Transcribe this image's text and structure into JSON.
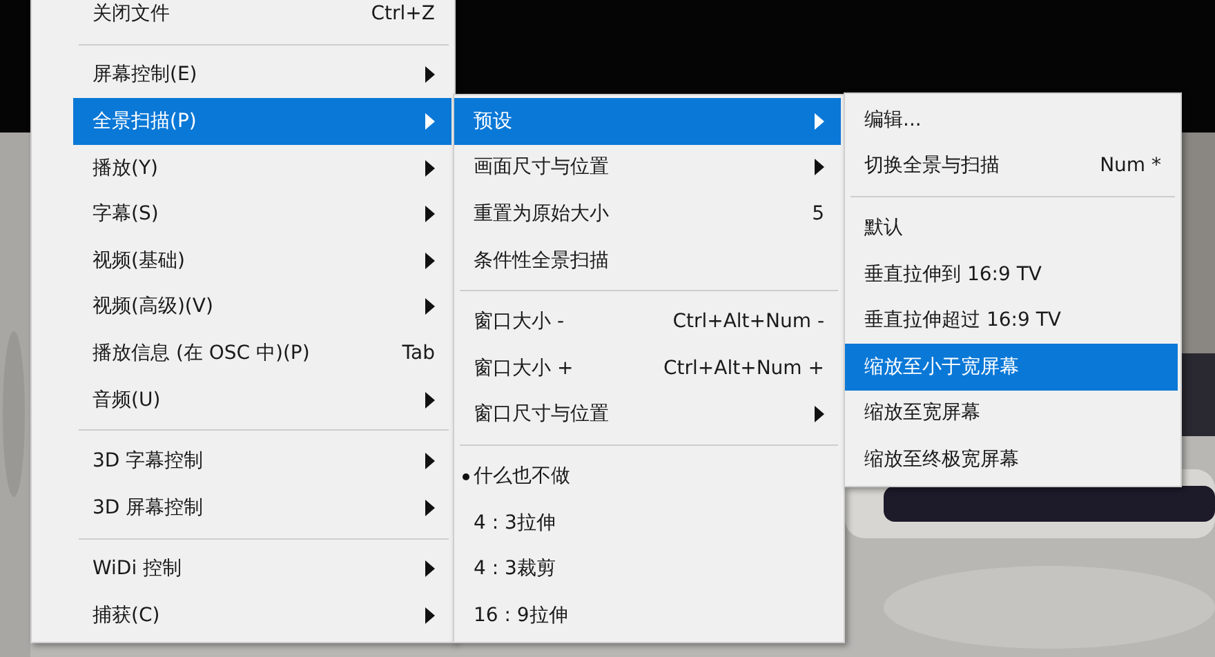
{
  "menus": [
    {
      "items": [
        {
          "kind": "command",
          "label": "关闭文件",
          "shortcut": "Ctrl+Z",
          "submenu": false,
          "selected": false
        },
        {
          "kind": "separator"
        },
        {
          "kind": "command",
          "label": "屏幕控制(E)",
          "submenu": true,
          "selected": false
        },
        {
          "kind": "command",
          "label": "全景扫描(P)",
          "submenu": true,
          "selected": true
        },
        {
          "kind": "command",
          "label": "播放(Y)",
          "submenu": true,
          "selected": false
        },
        {
          "kind": "command",
          "label": "字幕(S)",
          "submenu": true,
          "selected": false
        },
        {
          "kind": "command",
          "label": "视频(基础)",
          "submenu": true,
          "selected": false
        },
        {
          "kind": "command",
          "label": "视频(高级)(V)",
          "submenu": true,
          "selected": false
        },
        {
          "kind": "command",
          "label": "播放信息 (在 OSC 中)(P)",
          "shortcut": "Tab",
          "submenu": false,
          "selected": false
        },
        {
          "kind": "command",
          "label": "音频(U)",
          "submenu": true,
          "selected": false
        },
        {
          "kind": "separator"
        },
        {
          "kind": "command",
          "label": "3D 字幕控制",
          "submenu": true,
          "selected": false
        },
        {
          "kind": "command",
          "label": "3D 屏幕控制",
          "submenu": true,
          "selected": false
        },
        {
          "kind": "separator"
        },
        {
          "kind": "command",
          "label": "WiDi 控制",
          "submenu": true,
          "selected": false
        },
        {
          "kind": "command",
          "label": "捕获(C)",
          "submenu": true,
          "selected": false
        }
      ]
    },
    {
      "items": [
        {
          "kind": "command",
          "label": "预设",
          "submenu": true,
          "selected": true
        },
        {
          "kind": "command",
          "label": "画面尺寸与位置",
          "submenu": true,
          "selected": false
        },
        {
          "kind": "command",
          "label": "重置为原始大小",
          "shortcut": "5",
          "submenu": false,
          "selected": false
        },
        {
          "kind": "command",
          "label": "条件性全景扫描",
          "submenu": false,
          "selected": false
        },
        {
          "kind": "separator"
        },
        {
          "kind": "command",
          "label": "窗口大小 -",
          "shortcut": "Ctrl+Alt+Num -",
          "submenu": false,
          "selected": false
        },
        {
          "kind": "command",
          "label": "窗口大小 +",
          "shortcut": "Ctrl+Alt+Num +",
          "submenu": false,
          "selected": false
        },
        {
          "kind": "command",
          "label": "窗口尺寸与位置",
          "submenu": true,
          "selected": false
        },
        {
          "kind": "separator"
        },
        {
          "kind": "radio",
          "label": "什么也不做",
          "checked": true,
          "selected": false
        },
        {
          "kind": "radio",
          "label": "4 : 3拉伸",
          "checked": false,
          "selected": false
        },
        {
          "kind": "radio",
          "label": "4 : 3裁剪",
          "checked": false,
          "selected": false
        },
        {
          "kind": "radio",
          "label": "16 : 9拉伸",
          "checked": false,
          "selected": false
        }
      ]
    },
    {
      "items": [
        {
          "kind": "command",
          "label": "编辑...",
          "submenu": false,
          "selected": false
        },
        {
          "kind": "command",
          "label": "切换全景与扫描",
          "shortcut": "Num *",
          "submenu": false,
          "selected": false
        },
        {
          "kind": "separator"
        },
        {
          "kind": "command",
          "label": "默认",
          "submenu": false,
          "selected": false
        },
        {
          "kind": "command",
          "label": "垂直拉伸到 16:9 TV",
          "submenu": false,
          "selected": false
        },
        {
          "kind": "command",
          "label": "垂直拉伸超过 16:9 TV",
          "submenu": false,
          "selected": false
        },
        {
          "kind": "command",
          "label": "缩放至小于宽屏幕",
          "submenu": false,
          "selected": true
        },
        {
          "kind": "command",
          "label": "缩放至宽屏幕",
          "submenu": false,
          "selected": false
        },
        {
          "kind": "command",
          "label": "缩放至终极宽屏幕",
          "submenu": false,
          "selected": false
        }
      ]
    }
  ]
}
